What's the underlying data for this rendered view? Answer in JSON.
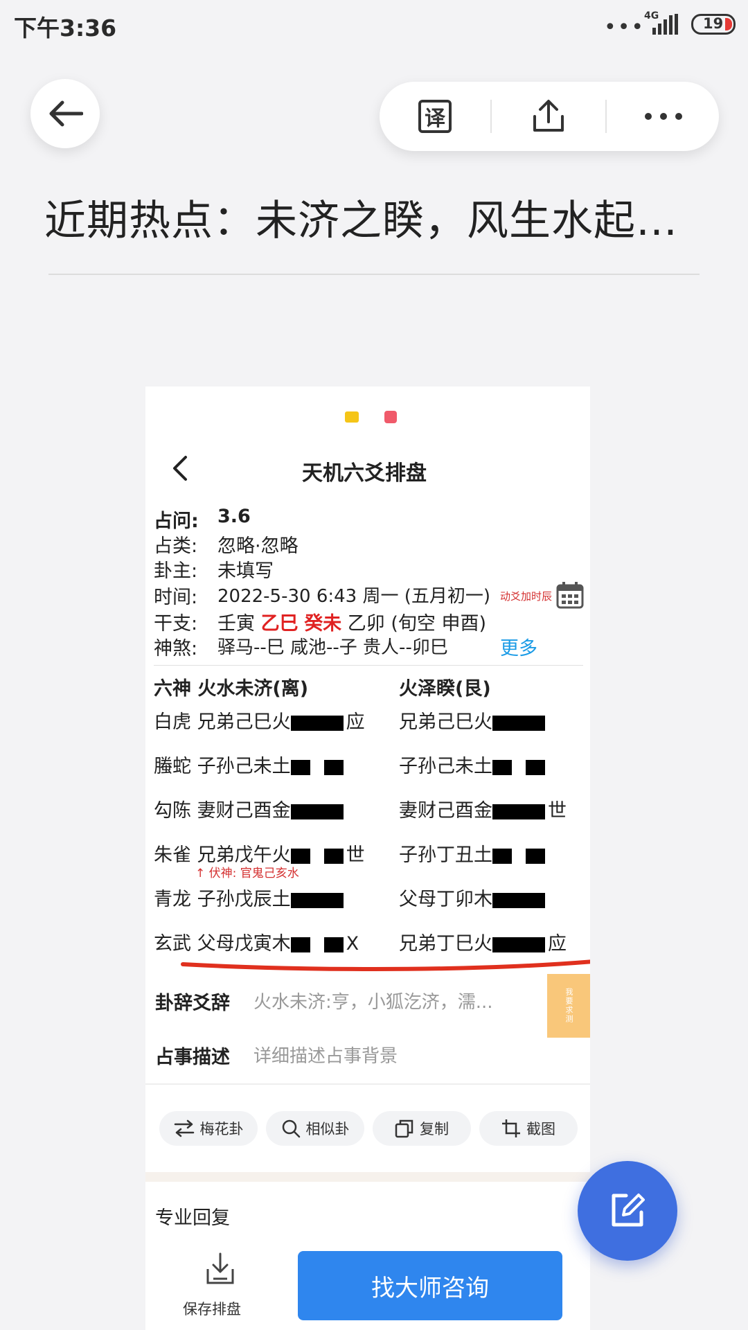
{
  "status_bar": {
    "time": "下午3:36",
    "network": "4G",
    "battery": "19"
  },
  "toolbar": {
    "translate_label": "译"
  },
  "article": {
    "title": "近期热点：未济之睽，风生水起…"
  },
  "embed": {
    "header_title": "天机六爻排盘",
    "info": {
      "question_label": "占问:",
      "question_value": "3.6",
      "category_label": "占类:",
      "category_value": "忽略·忽略",
      "owner_label": "卦主:",
      "owner_value": "未填写",
      "time_label": "时间:",
      "time_value": "2022-5-30 6:43 周一 (五月初一)",
      "time_note": "动爻加时辰",
      "ganzhi_label": "干支:",
      "ganzhi_1": "壬寅",
      "ganzhi_2": "乙巳",
      "ganzhi_3": "癸未",
      "ganzhi_4": "乙卯 (旬空 申酉)",
      "shensha_label": "神煞:",
      "shensha_value": "驿马--巳  咸池--子  贵人--卯巳",
      "more_link": "更多"
    },
    "hexagram": {
      "col_header_left": "六神  火水未济(离)",
      "col_header_right": "火泽睽(艮)",
      "rows": [
        {
          "spirit": "白虎",
          "left": "兄弟己巳火",
          "right": "兄弟己巳火",
          "left_tag": "应",
          "right_tag": ""
        },
        {
          "spirit": "螣蛇",
          "left": "子孙己未土",
          "right": "子孙己未土",
          "left_tag": "",
          "right_tag": ""
        },
        {
          "spirit": "勾陈",
          "left": "妻财己酉金",
          "right": "妻财己酉金",
          "left_tag": "",
          "right_tag": "世"
        },
        {
          "spirit": "朱雀",
          "left": "兄弟戊午火",
          "right": "子孙丁丑土",
          "left_tag": "世",
          "right_tag": ""
        },
        {
          "spirit": "青龙",
          "left": "子孙戊辰土",
          "right": "父母丁卯木",
          "left_tag": "",
          "right_tag": ""
        },
        {
          "spirit": "玄武",
          "left": "父母戊寅木",
          "right": "兄弟丁巳火",
          "left_tag": "X",
          "right_tag": "应"
        }
      ],
      "fushen_note": "↑ 伏神: 官鬼己亥水"
    },
    "guaci_label": "卦辞爻辞",
    "guaci_value": "火水未济:亨，小狐汔济，濡...",
    "side_tab": "我要求测",
    "desc_label": "占事描述",
    "desc_placeholder": "详细描述占事背景",
    "chips": [
      "梅花卦",
      "相似卦",
      "复制",
      "截图"
    ],
    "reply_label": "专业回复",
    "save_label": "保存排盘",
    "consult_label": "找大师咨询"
  },
  "colors": {
    "accent_blue": "#2f86ee",
    "fab_blue": "#3f6fe0",
    "underline_red": "#e0301e"
  }
}
